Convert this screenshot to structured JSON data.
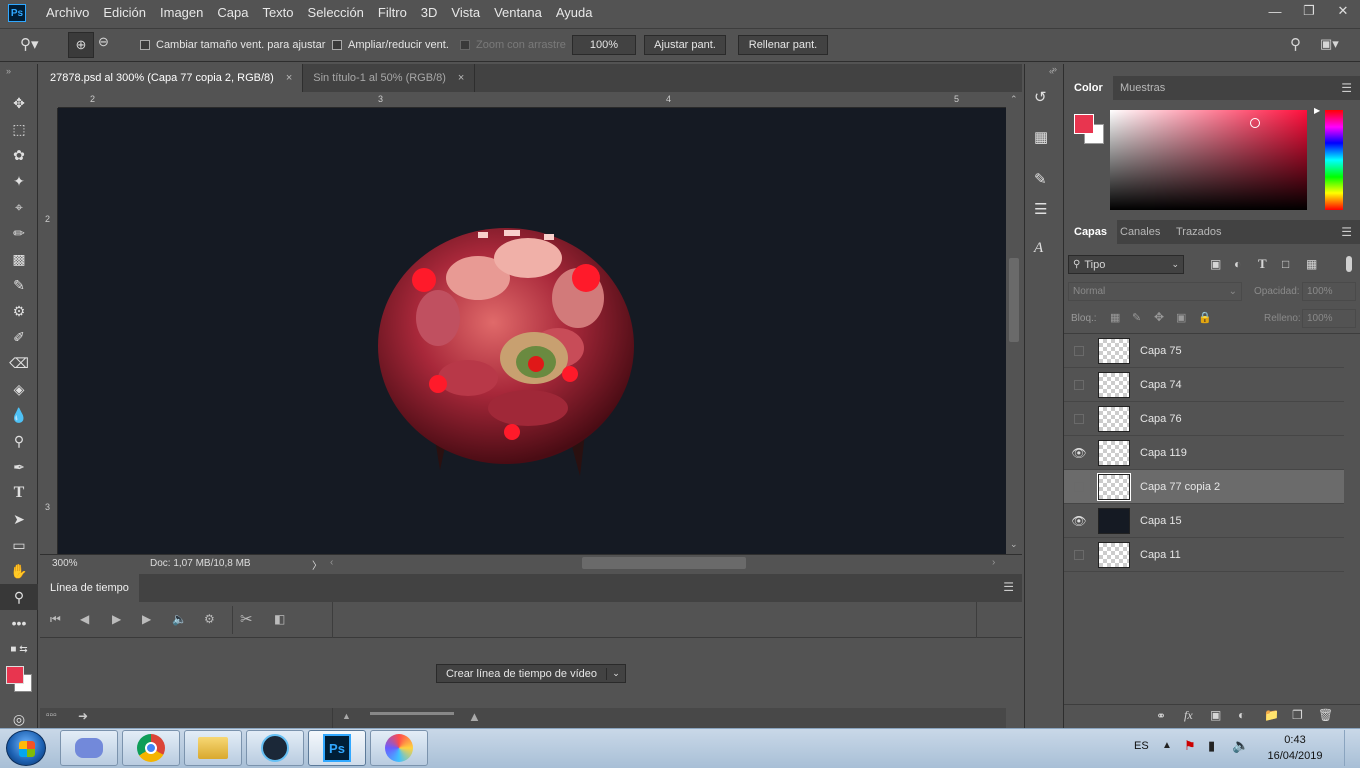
{
  "app": {
    "logo": "Ps"
  },
  "menu": [
    "Archivo",
    "Edición",
    "Imagen",
    "Capa",
    "Texto",
    "Selección",
    "Filtro",
    "3D",
    "Vista",
    "Ventana",
    "Ayuda"
  ],
  "options": {
    "resize_windows": "Cambiar tamaño vent. para ajustar",
    "zoom_all": "Ampliar/reducir vent.",
    "scrubby_zoom": "Zoom con arrastre",
    "zoom_value": "100%",
    "fit_screen": "Ajustar pant.",
    "fill_screen": "Rellenar pant."
  },
  "tabs": [
    {
      "label": "27878.psd al 300% (Capa 77 copia 2, RGB/8)",
      "close": "×"
    },
    {
      "label": "Sin título-1 al 50% (RGB/8)",
      "close": "×"
    }
  ],
  "ruler": {
    "top": [
      "2",
      "3",
      "4",
      "5"
    ],
    "left": [
      "2",
      "3"
    ]
  },
  "status": {
    "zoom": "300%",
    "doc": "Doc: 1,07 MB/10,8 MB"
  },
  "timeline": {
    "title": "Línea de tiempo",
    "create_button": "Crear línea de tiempo de vídeo"
  },
  "color_panel": {
    "tabs": [
      "Color",
      "Muestras"
    ],
    "foreground": "#e8354f",
    "background": "#ffffff"
  },
  "layers_panel": {
    "tabs": [
      "Capas",
      "Canales",
      "Trazados"
    ],
    "filter": "Tipo",
    "blend_mode": "Normal",
    "opacity_label": "Opacidad:",
    "opacity_value": "100%",
    "lock_label": "Bloq.:",
    "fill_label": "Relleno:",
    "fill_value": "100%",
    "layers": [
      {
        "name": "Capa 75",
        "visible": false,
        "selected": false
      },
      {
        "name": "Capa 74",
        "visible": false,
        "selected": false
      },
      {
        "name": "Capa 76",
        "visible": false,
        "selected": false
      },
      {
        "name": "Capa 119",
        "visible": true,
        "selected": false
      },
      {
        "name": "Capa 77 copia 2",
        "visible": false,
        "selected": true
      },
      {
        "name": "Capa 15",
        "visible": true,
        "selected": false
      },
      {
        "name": "Capa 11",
        "visible": false,
        "selected": false
      }
    ],
    "footer_fx": "fx"
  },
  "taskbar": {
    "apps": [
      "discord-icon",
      "chrome-icon",
      "explorer-icon",
      "steam-icon",
      "photoshop-icon",
      "paint-icon"
    ],
    "photoshop_label": "Ps",
    "language": "ES",
    "time": "0:43",
    "date": "16/04/2019"
  }
}
